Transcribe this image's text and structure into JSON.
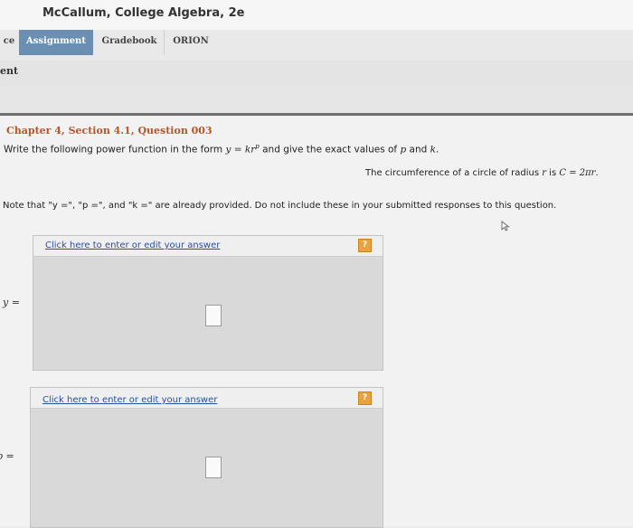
{
  "header": {
    "course_title": "McCallum, College Algebra, 2e"
  },
  "tabs": {
    "partial": "ce",
    "assignment": "Assignment",
    "gradebook": "Gradebook",
    "orion": "ORION"
  },
  "subheader": {
    "partial": "ent"
  },
  "question": {
    "chapter_label": "Chapter 4, Section 4.1, Question 003",
    "instruction_pre": "Write the following power function in the form ",
    "instruction_formula": "y = kr",
    "instruction_exp": "p",
    "instruction_mid": " and give the exact values of ",
    "instruction_p": "p",
    "instruction_and": " and ",
    "instruction_k": "k",
    "instruction_end": ".",
    "circ_pre": "The circumference of a circle of radius ",
    "circ_r": "r",
    "circ_is": " is ",
    "circ_formula": "C = 2πr",
    "circ_end": ".",
    "note": "Note that \"y =\", \"p =\", and \"k =\" are already provided. Do not include these in your submitted responses to this question."
  },
  "answers": [
    {
      "link": "Click here to enter or edit your answer",
      "variable": "y =",
      "help": "?"
    },
    {
      "link": "Click here to enter or edit your answer",
      "variable": "p =",
      "help": "?"
    }
  ]
}
